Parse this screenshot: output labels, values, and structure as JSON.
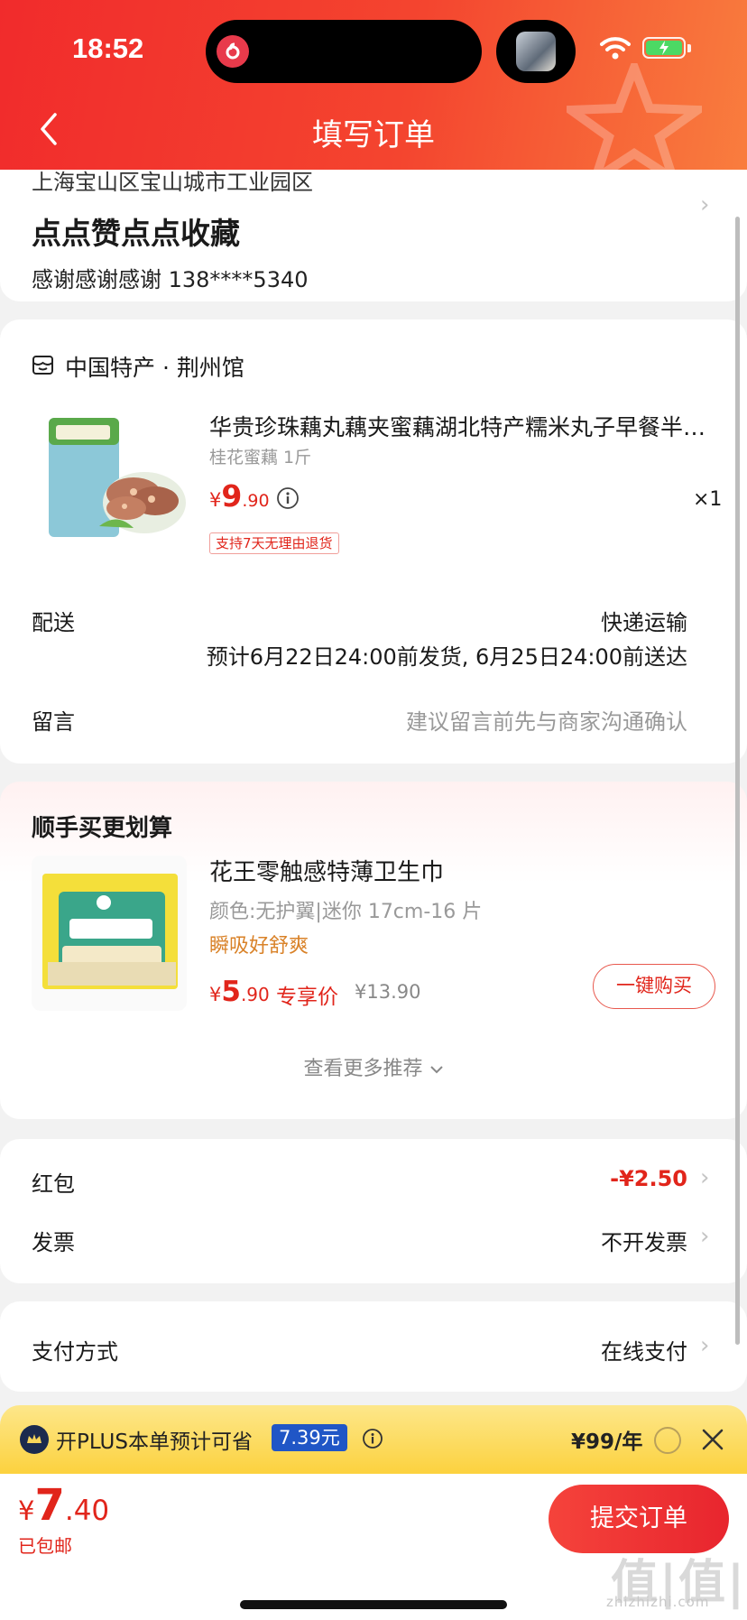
{
  "status_bar": {
    "time": "18:52"
  },
  "header": {
    "title": "填写订单"
  },
  "address": {
    "region": "上海宝山区宝山城市工业园区",
    "detail": "点点赞点点收藏",
    "contact": "感谢感谢感谢  138****5340"
  },
  "store": {
    "name": "中国特产 · 荆州馆"
  },
  "product": {
    "title": "华贵珍珠藕丸藕夹蜜藕湖北特产糯米丸子早餐半成品",
    "spec": "桂花蜜藕 1斤",
    "price_currency": "¥",
    "price_int": "9",
    "price_dec": ".90",
    "quantity": "×1",
    "tag": "支持7天无理由退货"
  },
  "delivery": {
    "label": "配送",
    "method": "快递运输",
    "estimate": "预计6月22日24:00前发货, 6月25日24:00前送达"
  },
  "message": {
    "label": "留言",
    "placeholder": "建议留言前先与商家沟通确认"
  },
  "recommend": {
    "title": "顺手买更划算",
    "name": "花王零触感特薄卫生巾",
    "spec": "颜色:无护翼|迷你 17cm-16 片",
    "slogan": "瞬吸好舒爽",
    "price_currency": "¥",
    "price_int": "5",
    "price_dec": ".90",
    "exclusive": "专享价",
    "original": "¥13.90",
    "buy_label": "一键购买",
    "more_label": "查看更多推荐"
  },
  "discounts": {
    "red_packet_label": "红包",
    "red_packet_value": "-¥2.50",
    "invoice_label": "发票",
    "invoice_value": "不开发票"
  },
  "payment": {
    "label": "支付方式",
    "value": "在线支付"
  },
  "plus": {
    "text": "开PLUS本单预计可省",
    "amount": "7.39元",
    "price": "¥99/年"
  },
  "footer": {
    "total_currency": "¥",
    "total_int": "7",
    "total_dec": ".40",
    "shipping": "已包邮",
    "submit_label": "提交订单",
    "watermark": "值|值|值",
    "watermark_url": "zhizhizhi.com"
  },
  "colors": {
    "brand_red": "#e1251b",
    "header_start": "#f12b2c",
    "header_end": "#f97d3e",
    "plus_yellow": "#fcd13c"
  }
}
